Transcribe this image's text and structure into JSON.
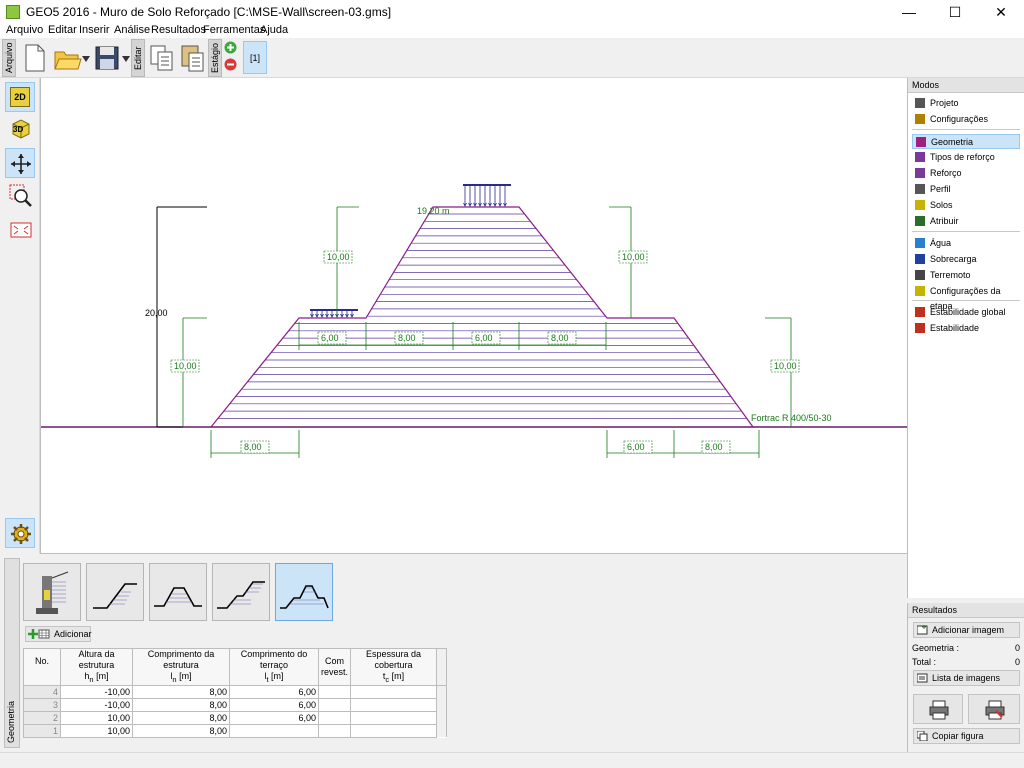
{
  "window": {
    "title": "GEO5 2016 - Muro de Solo Reforçado [C:\\MSE-Wall\\screen-03.gms]",
    "minimize": "—",
    "maximize": "☐",
    "close": "✕"
  },
  "menu": [
    "Arquivo",
    "Editar",
    "Inserir",
    "Análise",
    "Resultados",
    "Ferramentas",
    "Ajuda"
  ],
  "toolbar": {
    "arquivo_label": "Arquivo",
    "editar_label": "Editar",
    "estagio_label": "Estágio",
    "stage_button": "[1]"
  },
  "left_tools": {
    "view_2d": "2D",
    "view_3d": "3D"
  },
  "drawing": {
    "total_height": "20,00",
    "top_load_label": "19,20 m",
    "upper_height_left": "10,00",
    "upper_height_right": "10,00",
    "lower_height_left": "10,00",
    "lower_height_right": "10,00",
    "terrace_dims": [
      "6,00",
      "8,00",
      "6,00",
      "8,00"
    ],
    "bottom_left_dim": "8,00",
    "bottom_right_dims": [
      "6,00",
      "8,00"
    ],
    "reinforcement_label": "Fortrac R 400/50-30"
  },
  "modes": {
    "header": "Modos",
    "items": [
      {
        "label": "Projeto",
        "color": "#555555"
      },
      {
        "label": "Configurações",
        "color": "#b08000"
      },
      {
        "label": "Geometria",
        "color": "#a02080"
      },
      {
        "label": "Tipos de reforço",
        "color": "#7a3a9a"
      },
      {
        "label": "Reforço",
        "color": "#7a3a9a"
      },
      {
        "label": "Perfil",
        "color": "#555555"
      },
      {
        "label": "Solos",
        "color": "#c8b400"
      },
      {
        "label": "Atribuir",
        "color": "#2a6e2a"
      },
      {
        "label": "Água",
        "color": "#2a7fd0"
      },
      {
        "label": "Sobrecarga",
        "color": "#2040a0"
      },
      {
        "label": "Terremoto",
        "color": "#444444"
      },
      {
        "label": "Configurações da etapa",
        "color": "#c8b400"
      },
      {
        "label": "Estabilidade global",
        "color": "#c03020"
      },
      {
        "label": "Estabilidade",
        "color": "#c03020"
      }
    ]
  },
  "results": {
    "header": "Resultados",
    "add_image": "Adicionar imagem",
    "geometry_label": "Geometria :",
    "geometry_value": "0",
    "total_label": "Total :",
    "total_value": "0",
    "image_list": "Lista de imagens",
    "copy_figure": "Copiar figura"
  },
  "bottom": {
    "tab_label": "Geometria",
    "add_button": "Adicionar",
    "table": {
      "headers": [
        {
          "line1": "No.",
          "line2": ""
        },
        {
          "line1": "Altura da estrutura",
          "line2": "h",
          "sub": "n",
          "unit": " [m]"
        },
        {
          "line1": "Comprimento da estrutura",
          "line2": "l",
          "sub": "n",
          "unit": " [m]"
        },
        {
          "line1": "Comprimento do terraço",
          "line2": "l",
          "sub": "t",
          "unit": " [m]"
        },
        {
          "line1": "Com",
          "line2": "revest."
        },
        {
          "line1": "Espessura da cobertura",
          "line2": "t",
          "sub": "c",
          "unit": " [m]"
        }
      ],
      "rows": [
        {
          "no": "4",
          "h": "-10,00",
          "l": "8,00",
          "lt": "6,00",
          "rev": "",
          "tc": ""
        },
        {
          "no": "3",
          "h": "-10,00",
          "l": "8,00",
          "lt": "6,00",
          "rev": "",
          "tc": ""
        },
        {
          "no": "2",
          "h": "10,00",
          "l": "8,00",
          "lt": "6,00",
          "rev": "",
          "tc": ""
        },
        {
          "no": "1",
          "h": "10,00",
          "l": "8,00",
          "lt": "",
          "rev": "",
          "tc": ""
        }
      ]
    }
  }
}
